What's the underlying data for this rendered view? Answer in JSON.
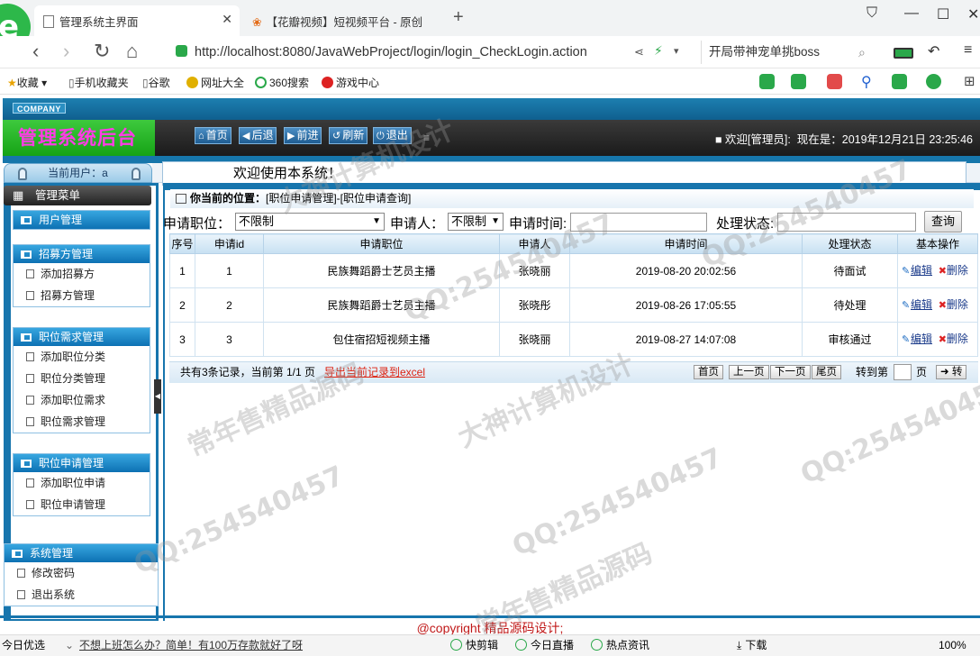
{
  "browser": {
    "tabs": [
      {
        "title": "管理系统主界面",
        "active": true
      },
      {
        "title": "【花瓣视频】短视频平台 - 原创",
        "active": false
      }
    ],
    "url": "http://localhost:8080/JavaWebProject/login/login_CheckLogin.action",
    "url_host": "localhost",
    "search_text": "开局带神宠单挑boss",
    "bookmarks": [
      "收藏",
      "手机收藏夹",
      "谷歌",
      "网址大全",
      "360搜索",
      "游戏中心"
    ]
  },
  "app": {
    "company_badge": "COMPANY",
    "title": "管理系统后台",
    "nav_buttons": [
      {
        "icon": "home-icon",
        "label": "首页"
      },
      {
        "icon": "back-icon",
        "label": "后退"
      },
      {
        "icon": "forward-icon",
        "label": "前进"
      },
      {
        "icon": "refresh-icon",
        "label": "刷新"
      },
      {
        "icon": "power-icon",
        "label": "退出"
      }
    ],
    "welcome_user": "■ 欢迎[管理员]:",
    "now_label": "现在是：2019年12月21日 23:25:46",
    "current_user": "当前用户：a",
    "welcome_msg": "欢迎使用本系统！",
    "menu_title": "管理菜单",
    "menu_groups": [
      {
        "title": "用户管理",
        "items": []
      },
      {
        "title": "招募方管理",
        "items": [
          "添加招募方",
          "招募方管理"
        ]
      },
      {
        "title": "职位需求管理",
        "items": [
          "添加职位分类",
          "职位分类管理",
          "添加职位需求",
          "职位需求管理"
        ]
      },
      {
        "title": "职位申请管理",
        "items": [
          "添加职位申请",
          "职位申请管理"
        ]
      },
      {
        "title": "系统管理",
        "items": [
          "修改密码",
          "退出系统"
        ]
      }
    ]
  },
  "location": {
    "label": "你当前的位置：",
    "path": "[职位申请管理]-[职位申请查询]"
  },
  "filter": {
    "position_label": "申请职位：",
    "position_value": "不限制",
    "applicant_label": "申请人：",
    "applicant_value": "不限制",
    "time_label": "申请时间:",
    "status_label": "处理状态:",
    "query_button": "查询"
  },
  "table": {
    "headers": [
      "序号",
      "申请id",
      "申请职位",
      "申请人",
      "申请时间",
      "处理状态",
      "基本操作"
    ],
    "rows": [
      {
        "seq": "1",
        "id": "1",
        "position": "民族舞蹈爵士艺员主播",
        "applicant": "张晓丽",
        "time": "2019-08-20 20:02:56",
        "status": "待面试"
      },
      {
        "seq": "2",
        "id": "2",
        "position": "民族舞蹈爵士艺员主播",
        "applicant": "张晓彤",
        "time": "2019-08-26 17:05:55",
        "status": "待处理"
      },
      {
        "seq": "3",
        "id": "3",
        "position": "包住宿招短视频主播",
        "applicant": "张晓丽",
        "time": "2019-08-27 14:07:08",
        "status": "审核通过"
      }
    ],
    "op_edit": "编辑",
    "op_delete": "删除"
  },
  "pager": {
    "summary": "共有3条记录，当前第 1/1 页",
    "export": "导出当前记录到excel",
    "first": "首页",
    "prev": "上一页",
    "next": "下一页",
    "last": "尾页",
    "goto_label": "转到第",
    "page_unit": "页",
    "go": "转"
  },
  "footer": "@copyright 精品源码设计;",
  "statusbar": {
    "left": "今日优选",
    "news": "不想上班怎么办？简单！有100万存款就好了呀",
    "items": [
      "快剪辑",
      "今日直播",
      "热点资讯",
      "下载",
      "100%"
    ]
  },
  "watermarks": [
    "QQ:254540457",
    "常年售精品源码",
    "大神计算机设计"
  ]
}
